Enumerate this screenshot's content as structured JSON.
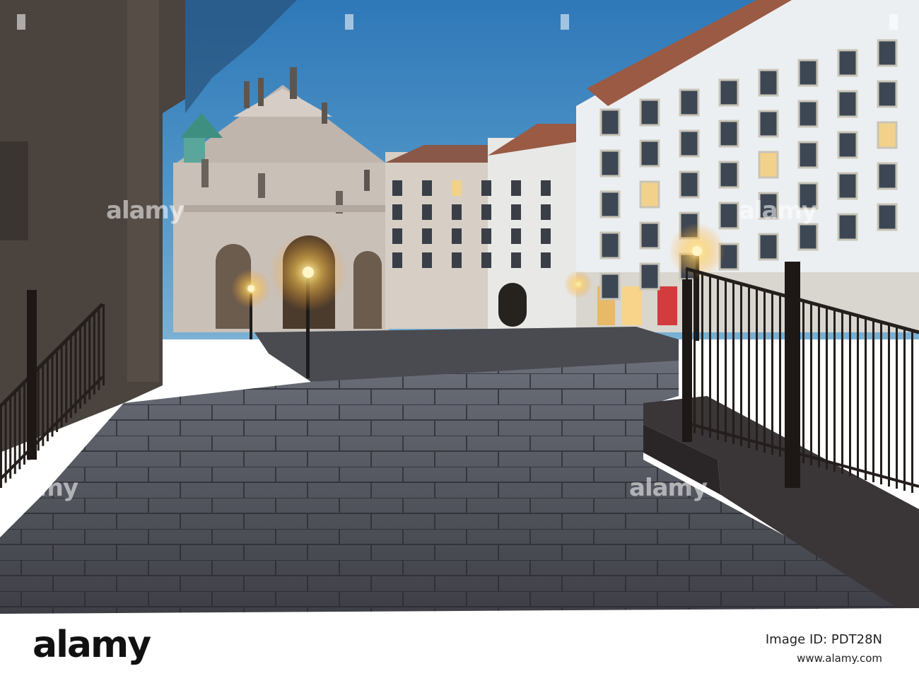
{
  "watermark": {
    "text": "alamy"
  },
  "footer": {
    "logo": "alamy",
    "image_id": "Image ID: PDT28N",
    "url": "www.alamy.com"
  }
}
